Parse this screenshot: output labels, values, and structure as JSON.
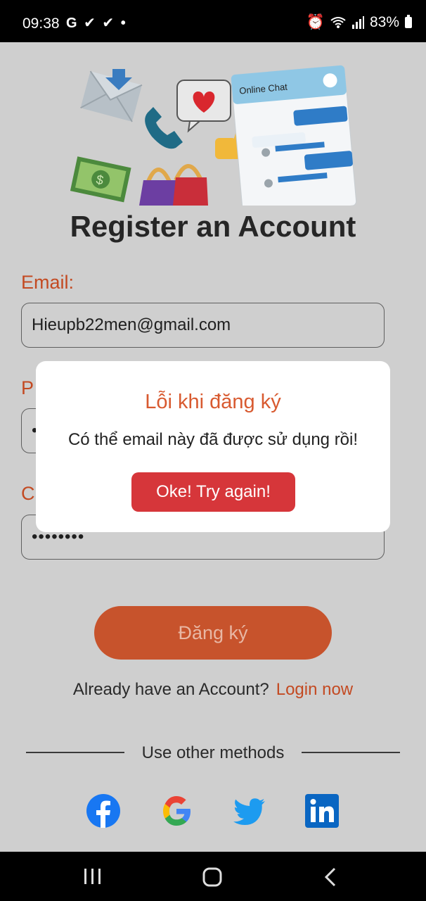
{
  "status_bar": {
    "time": "09:38",
    "left_icons": "G ✔ ✔ •",
    "battery_text": "83%"
  },
  "page": {
    "title": "Register an Account",
    "email_label": "Email:",
    "email_value": "Hieupb22men@gmail.com",
    "password_label": "P",
    "password_dots": "•",
    "confirm_label": "C",
    "confirm_value": "••••••••",
    "register_button": "Đăng ký",
    "login_prompt": "Already have an Account?",
    "login_link": "Login now",
    "other_methods": "Use other methods"
  },
  "illustration": {
    "chat_header": "Online Chat"
  },
  "dialog": {
    "title": "Lỗi khi đăng ký",
    "message": "Có thể email này đã được sử dụng rồi!",
    "button": "Oke! Try again!"
  },
  "colors": {
    "accent": "#c7532c",
    "dialog_title": "#d85a30",
    "dialog_button": "#d6363a"
  },
  "icons": [
    "facebook-icon",
    "google-icon",
    "twitter-icon",
    "linkedin-icon"
  ]
}
